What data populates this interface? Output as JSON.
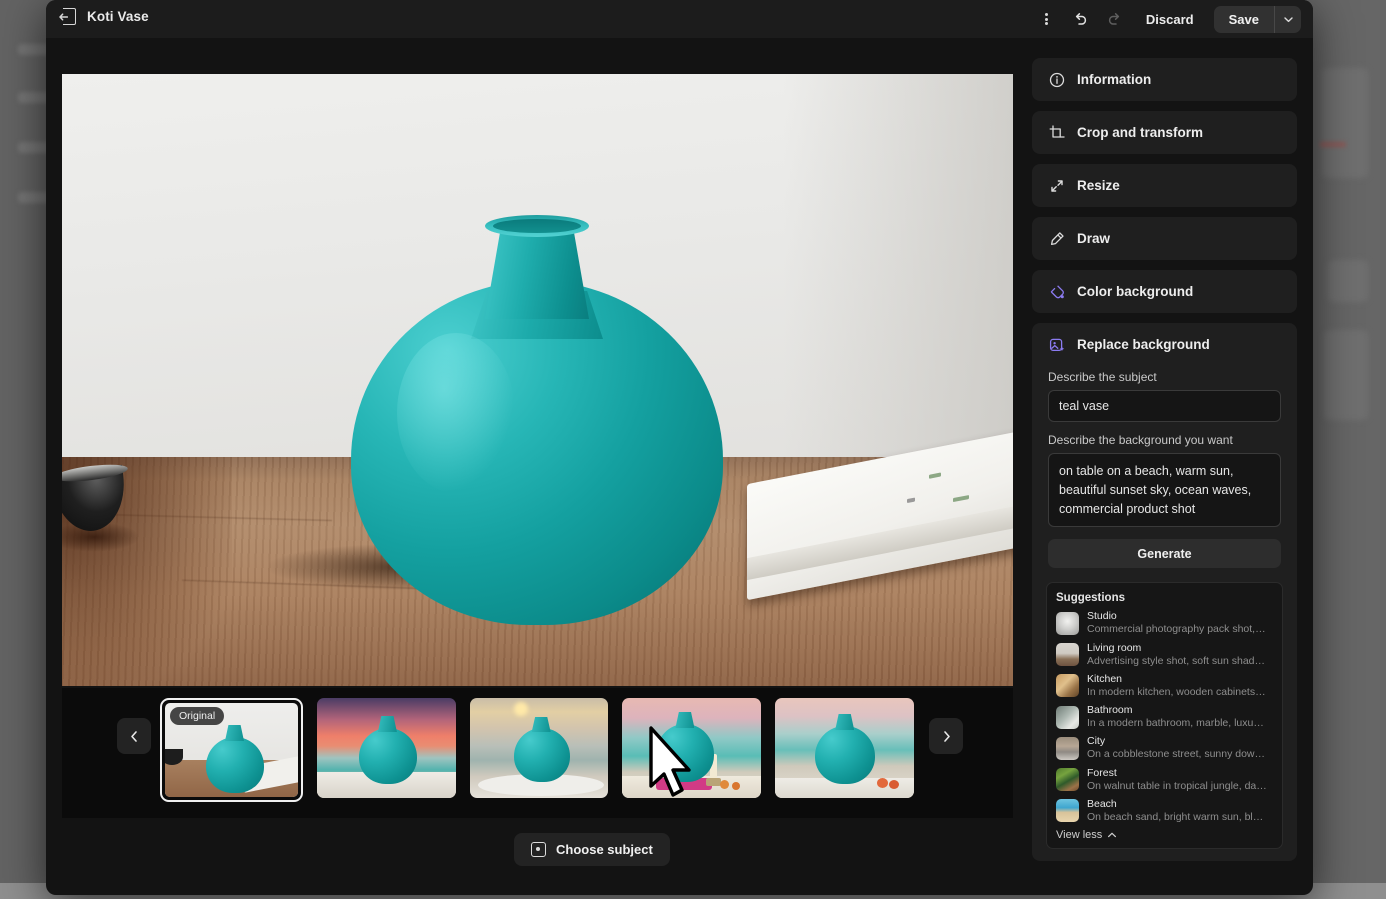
{
  "titlebar": {
    "exit_icon": "exit-icon",
    "title": "Koti Vase",
    "menu_icon": "kebab-menu-icon",
    "undo_icon": "undo-icon",
    "redo_icon": "redo-icon",
    "discard_label": "Discard",
    "save_label": "Save",
    "save_caret_icon": "chevron-down-icon"
  },
  "panel": {
    "tools": [
      {
        "label": "Information",
        "icon": "info-icon"
      },
      {
        "label": "Crop and transform",
        "icon": "crop-icon"
      },
      {
        "label": "Resize",
        "icon": "resize-icon"
      },
      {
        "label": "Draw",
        "icon": "marker-icon"
      },
      {
        "label": "Color background",
        "icon": "color-background-icon"
      }
    ],
    "replace_background": {
      "title": "Replace background",
      "icon": "replace-background-icon",
      "subject_label": "Describe the subject",
      "subject_value": "teal vase",
      "subject_placeholder": "Describe the subject",
      "background_label": "Describe the background you want",
      "background_value": "on table on a beach, warm sun, beautiful sunset sky, ocean waves, commercial product shot",
      "background_placeholder": "Describe the background you want",
      "generate_label": "Generate"
    },
    "suggestions": {
      "title": "Suggestions",
      "items": [
        {
          "name": "Studio",
          "desc": "Commercial photography pack shot,…"
        },
        {
          "name": "Living room",
          "desc": "Advertising style shot, soft sun shad…"
        },
        {
          "name": "Kitchen",
          "desc": "In modern kitchen, wooden cabinets…"
        },
        {
          "name": "Bathroom",
          "desc": "In a modern bathroom, marble, luxur…"
        },
        {
          "name": "City",
          "desc": "On a cobblestone street, sunny dow…"
        },
        {
          "name": "Forest",
          "desc": "On walnut table in tropical jungle, da…"
        },
        {
          "name": "Beach",
          "desc": "On beach sand, bright warm sun, bl…"
        }
      ],
      "view_less_label": "View less",
      "view_less_icon": "chevron-up-icon"
    }
  },
  "filmstrip": {
    "prev_icon": "chevron-left-icon",
    "next_icon": "chevron-right-icon",
    "original_badge": "Original",
    "thumbnails": [
      {
        "name": "original-thumbnail"
      },
      {
        "name": "variation-thumbnail-1"
      },
      {
        "name": "variation-thumbnail-2"
      },
      {
        "name": "variation-thumbnail-3"
      },
      {
        "name": "variation-thumbnail-4"
      }
    ]
  },
  "bottom_bar": {
    "choose_subject_label": "Choose subject",
    "choose_subject_icon": "subject-select-icon"
  },
  "colors": {
    "accent_purple": "#8b7bf0",
    "vase_teal": "#14a0a0",
    "panel_bg": "#1f1f1f",
    "window_bg": "#131313"
  }
}
